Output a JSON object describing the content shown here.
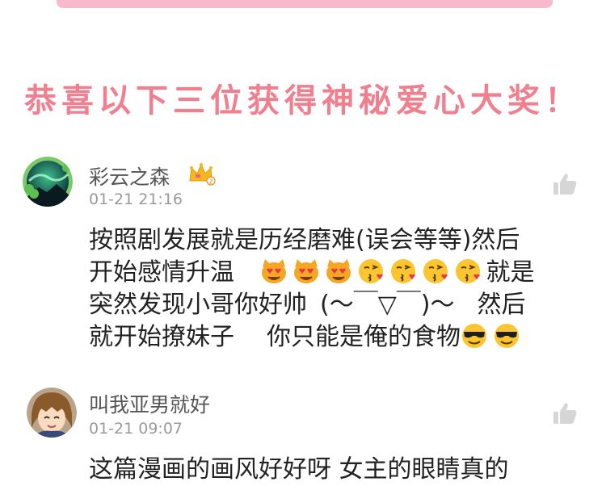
{
  "banner": {
    "text": "恭喜以下三位获得神秘爱心大奖！"
  },
  "comments": [
    {
      "username": "彩云之森",
      "timestamp": "01-21 21:16",
      "badge_icon": "crown-level-2-icon",
      "text_segments": {
        "l1": "按照剧发展就是历经磨难(误会等等)然后",
        "l2a": "开始感情升温",
        "l2b": "就是",
        "l3a": "突然发现小哥你好帅",
        "l3b": "(～￣▽￣)～",
        "l3c": "然后",
        "l4a": "就开始撩妹子",
        "l4b": "你只能是俺的食物"
      },
      "emojis": [
        "heart-eyes-cat-icon",
        "heart-eyes-cat-icon",
        "heart-eyes-cat-icon",
        "kissing-face-icon",
        "kissing-face-icon",
        "kissing-face-icon",
        "kissing-face-icon",
        "sunglasses-face-icon",
        "sunglasses-face-icon"
      ]
    },
    {
      "username": "叫我亚男就好",
      "timestamp": "01-21 09:07",
      "text_partial": "这篇漫画的画风好好呀 女主的眼睛真的"
    }
  ],
  "colors": {
    "banner_pink": "#f07f8f",
    "topbar_pink": "#f7b9cc",
    "like_gray": "#d6d6d6"
  }
}
